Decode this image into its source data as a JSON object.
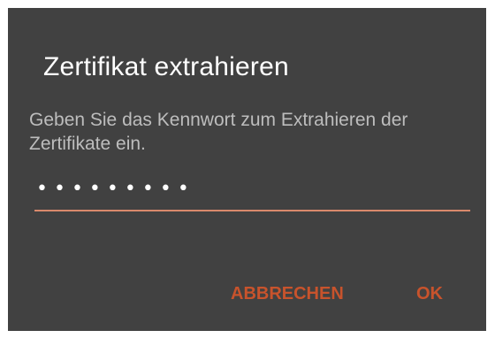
{
  "dialog": {
    "title": "Zertifikat extrahieren",
    "message": "Geben Sie das Kennwort zum Extrahieren der Zertifikate ein.",
    "password_value": "•••••••••",
    "accent_color": "#c8532c",
    "buttons": {
      "cancel_label": "ABBRECHEN",
      "ok_label": "OK"
    }
  }
}
